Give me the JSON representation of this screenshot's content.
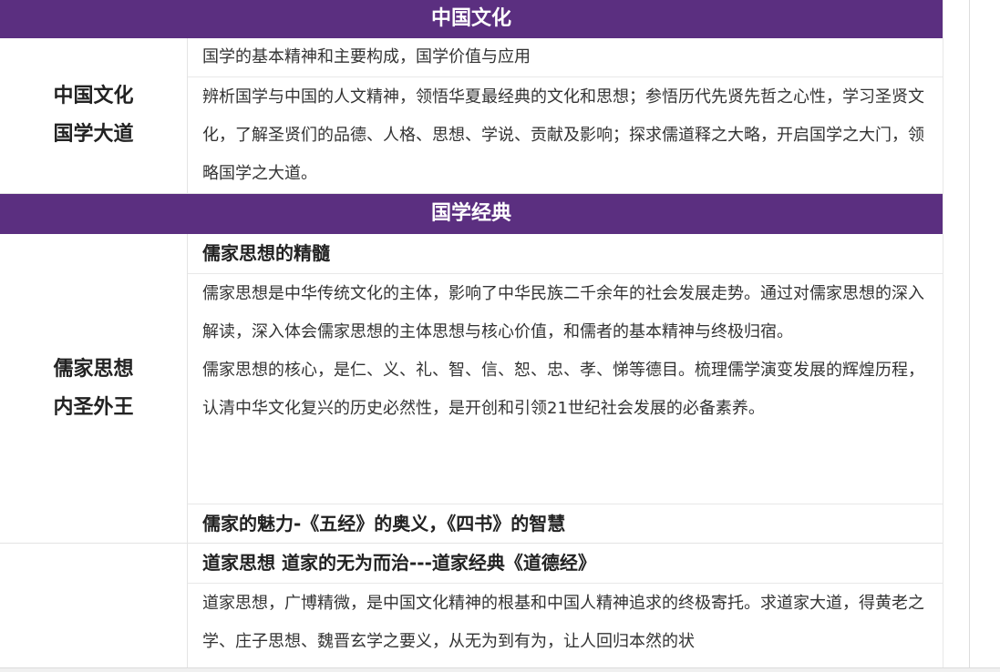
{
  "sections": [
    {
      "header": "中国文化",
      "left_lines": [
        "中国文化",
        "国学大道"
      ],
      "items": [
        "国学的基本精神和主要构成，国学价值与应用",
        "辨析国学与中国的人文精神，领悟华夏最经典的文化和思想；参悟历代先贤先哲之心性，学习圣贤文化，了解圣贤们的品德、人格、思想、学说、贡献及影响；探求儒道释之大略，开启国学之大门，领略国学之大道。"
      ]
    },
    {
      "header": "国学经典",
      "left_lines": [
        "儒家思想",
        "内圣外王"
      ],
      "title": "儒家思想的精髓",
      "paragraphs": [
        "儒家思想是中华传统文化的主体，影响了中华民族二千余年的社会发展走势。通过对儒家思想的深入解读，深入体会儒家思想的主体思想与核心价值，和儒者的基本精神与终极归宿。",
        "儒家思想的核心，是仁、义、礼、智、信、恕、忠、孝、悌等德目。梳理儒学演变发展的辉煌历程，认清中华文化复兴的历史必然性，是开创和引领21世纪社会发展的必备素养。"
      ],
      "subtitle": "儒家的魅力-《五经》的奥义，《四书》的智慧"
    },
    {
      "left_lines": [],
      "title": "道家思想 道家的无为而治---道家经典《道德经》",
      "paragraph": "道家思想，广博精微，是中国文化精神的根基和中国人精神追求的终极寄托。求道家大道，得黄老之学、庄子思想、魏晋玄学之要义，从无为到有为，让人回归本然的状"
    }
  ],
  "colors": {
    "header_bg": "#5b2f80",
    "header_text": "#ffffff",
    "body_text": "#333333",
    "border": "#e4e4e4"
  }
}
